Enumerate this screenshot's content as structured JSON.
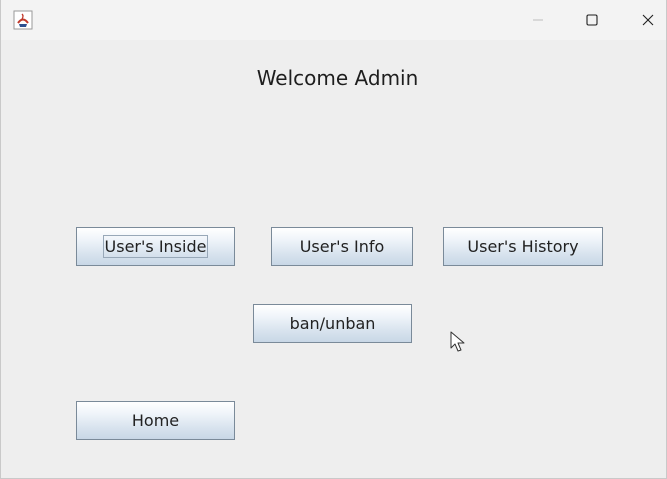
{
  "window": {
    "app_icon": "java-cup-icon",
    "controls": {
      "minimize_icon": "minimize-icon",
      "maximize_icon": "maximize-icon",
      "close_icon": "close-icon"
    }
  },
  "main": {
    "title": "Welcome Admin",
    "buttons": {
      "users_inside": "User's Inside",
      "users_info": "User's Info",
      "users_history": "User's History",
      "ban_unban": "ban/unban",
      "home": "Home"
    }
  },
  "pointer": {
    "icon": "mouse-pointer-icon"
  },
  "colors": {
    "window_bg": "#eeeeee",
    "titlebar_bg": "#f3f3f3",
    "button_border": "#7a8a99",
    "button_gradient_bottom": "#c8d7e6"
  }
}
